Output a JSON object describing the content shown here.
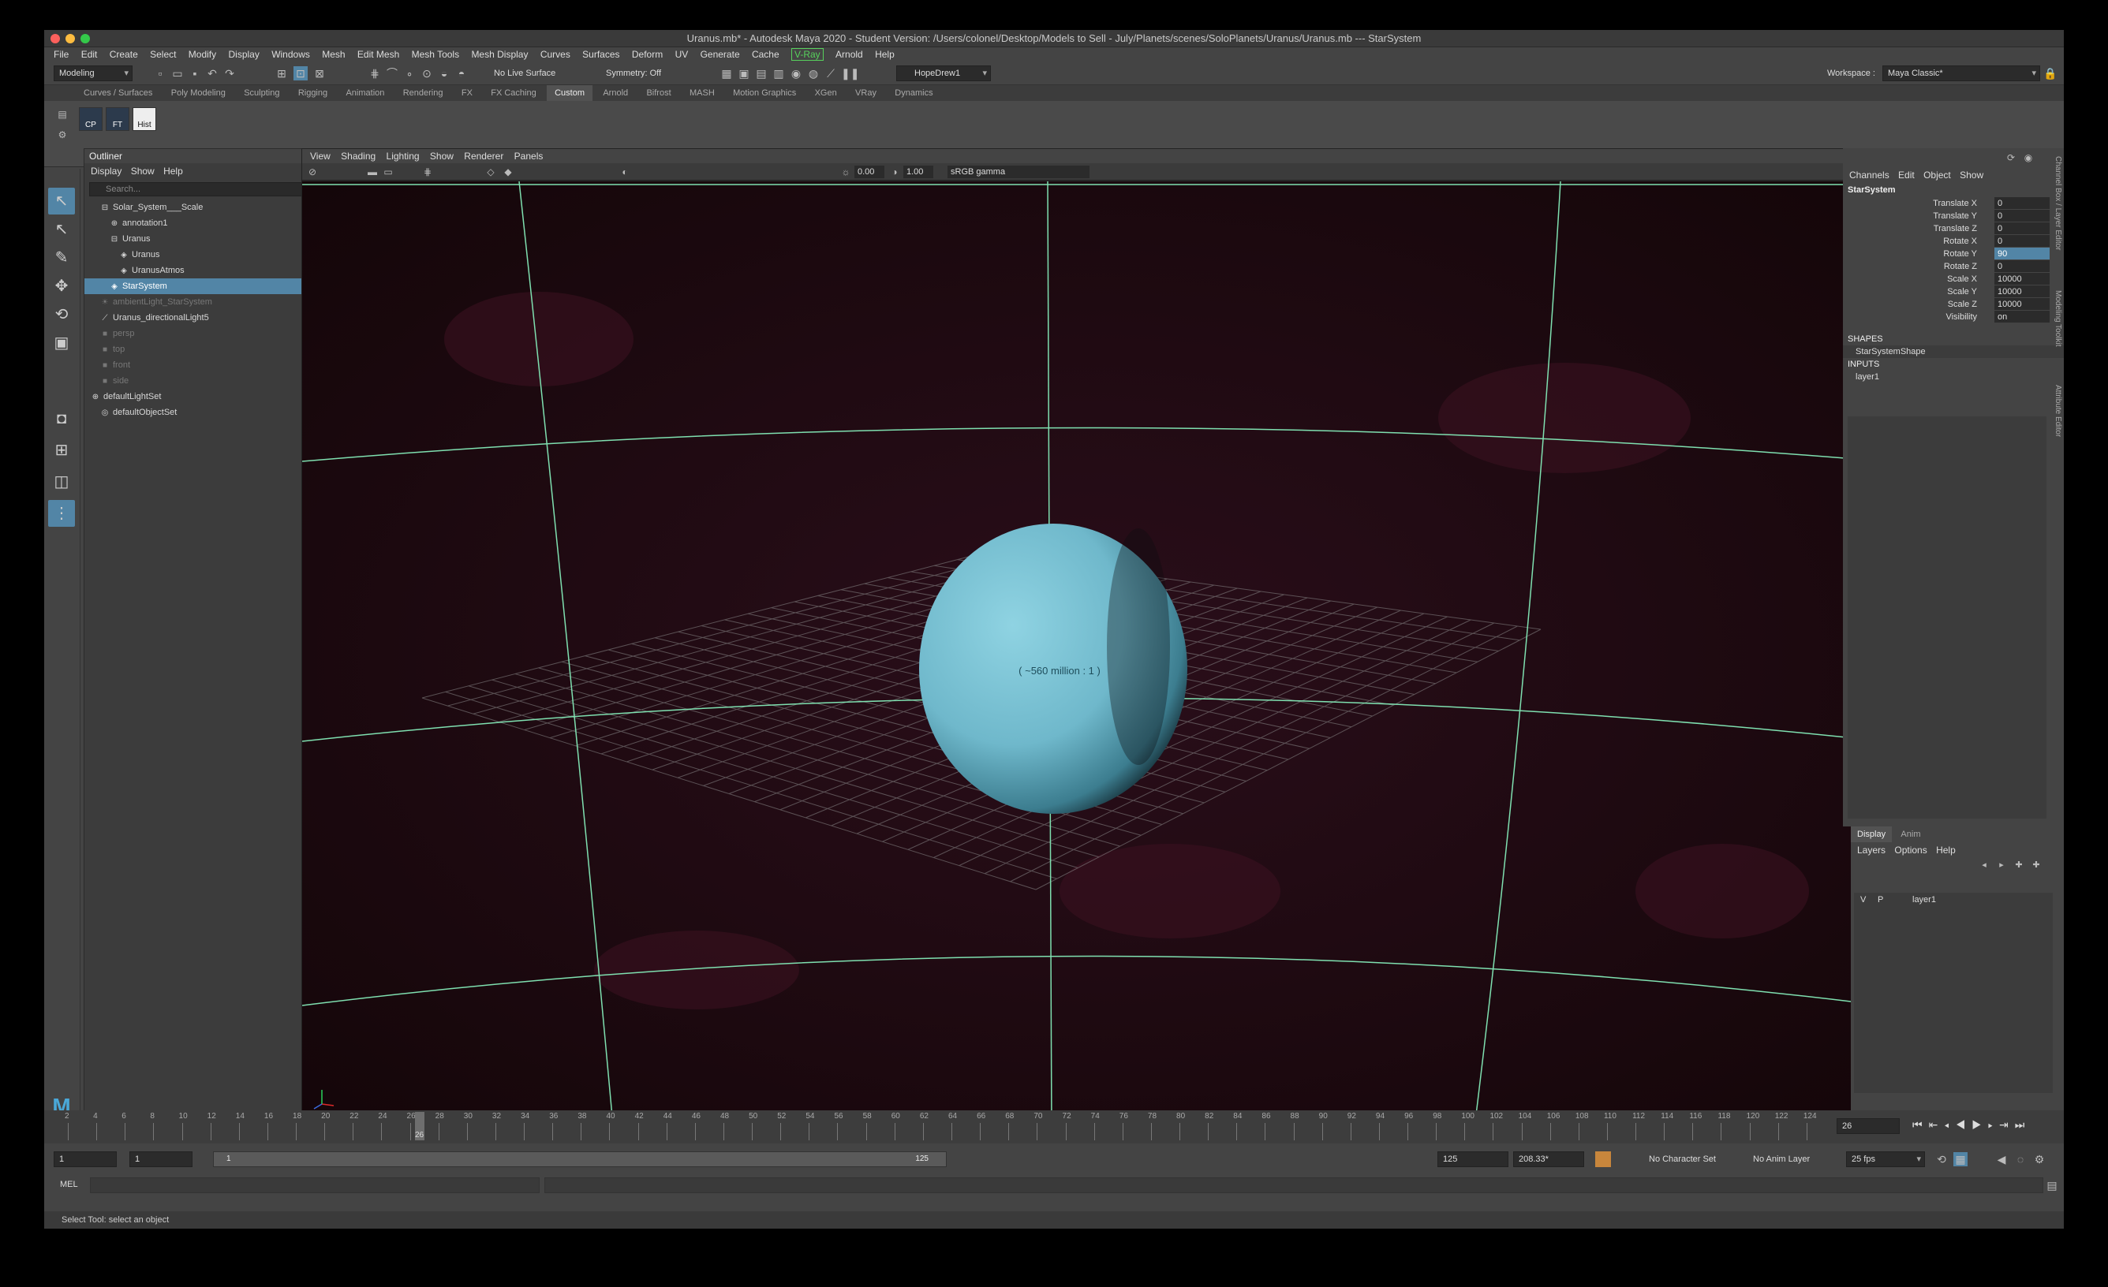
{
  "window": {
    "title": "Uranus.mb* - Autodesk Maya 2020 - Student Version: /Users/colonel/Desktop/Models to Sell - July/Planets/scenes/SoloPlanets/Uranus/Uranus.mb  ---  StarSystem"
  },
  "menubar": [
    "File",
    "Edit",
    "Create",
    "Select",
    "Modify",
    "Display",
    "Windows",
    "Mesh",
    "Edit Mesh",
    "Mesh Tools",
    "Mesh Display",
    "Curves",
    "Surfaces",
    "Deform",
    "UV",
    "Generate",
    "Cache",
    "V-Ray",
    "Arnold",
    "Help"
  ],
  "statusline": {
    "mode": "Modeling",
    "live_surface": "No Live Surface",
    "symmetry": "Symmetry: Off",
    "renderer_cam": "HopeDrew1",
    "workspace_label": "Workspace :",
    "workspace": "Maya Classic*"
  },
  "shelf_tabs": [
    "Curves / Surfaces",
    "Poly Modeling",
    "Sculpting",
    "Rigging",
    "Animation",
    "Rendering",
    "FX",
    "FX Caching",
    "Custom",
    "Arnold",
    "Bifrost",
    "MASH",
    "Motion Graphics",
    "XGen",
    "VRay",
    "Dynamics"
  ],
  "shelf_active": "Custom",
  "shelf_buttons": [
    "CP",
    "FT",
    "Hist"
  ],
  "outliner": {
    "title": "Outliner",
    "menu": [
      "Display",
      "Show",
      "Help"
    ],
    "search_placeholder": "Search...",
    "items": [
      {
        "label": "Solar_System___Scale",
        "indent": 1,
        "icon": "⊟",
        "state": "normal"
      },
      {
        "label": "annotation1",
        "indent": 2,
        "icon": "⊕",
        "state": "normal"
      },
      {
        "label": "Uranus",
        "indent": 2,
        "icon": "⊟",
        "state": "normal"
      },
      {
        "label": "Uranus",
        "indent": 3,
        "icon": "◈",
        "state": "normal"
      },
      {
        "label": "UranusAtmos",
        "indent": 3,
        "icon": "◈",
        "state": "normal"
      },
      {
        "label": "StarSystem",
        "indent": 2,
        "icon": "◈",
        "state": "selected"
      },
      {
        "label": "ambientLight_StarSystem",
        "indent": 1,
        "icon": "☀",
        "state": "dim"
      },
      {
        "label": "Uranus_directionalLight5",
        "indent": 1,
        "icon": "⟋",
        "state": "normal"
      },
      {
        "label": "persp",
        "indent": 1,
        "icon": "■",
        "state": "dim"
      },
      {
        "label": "top",
        "indent": 1,
        "icon": "■",
        "state": "dim"
      },
      {
        "label": "front",
        "indent": 1,
        "icon": "■",
        "state": "dim"
      },
      {
        "label": "side",
        "indent": 1,
        "icon": "■",
        "state": "dim"
      },
      {
        "label": "defaultLightSet",
        "indent": 0,
        "icon": "⊕",
        "state": "normal"
      },
      {
        "label": "defaultObjectSet",
        "indent": 1,
        "icon": "◎",
        "state": "normal"
      }
    ]
  },
  "viewport": {
    "menu": [
      "View",
      "Shading",
      "Lighting",
      "Show",
      "Renderer",
      "Panels"
    ],
    "exposure": "0.00",
    "gamma": "1.00",
    "color_space": "sRGB gamma",
    "annotation": "( ~560 million : 1 )",
    "camera": "persp"
  },
  "channel_box": {
    "menu": [
      "Channels",
      "Edit",
      "Object",
      "Show"
    ],
    "object": "StarSystem",
    "attributes": [
      {
        "name": "Translate X",
        "value": "0"
      },
      {
        "name": "Translate Y",
        "value": "0"
      },
      {
        "name": "Translate Z",
        "value": "0"
      },
      {
        "name": "Rotate X",
        "value": "0"
      },
      {
        "name": "Rotate Y",
        "value": "90",
        "highlight": true
      },
      {
        "name": "Rotate Z",
        "value": "0"
      },
      {
        "name": "Scale X",
        "value": "10000"
      },
      {
        "name": "Scale Y",
        "value": "10000"
      },
      {
        "name": "Scale Z",
        "value": "10000"
      },
      {
        "name": "Visibility",
        "value": "on"
      }
    ],
    "shapes_header": "SHAPES",
    "shape": "StarSystemShape",
    "inputs_header": "INPUTS",
    "input": "layer1"
  },
  "side_tabs": [
    "Channel Box / Layer Editor",
    "Modeling Toolkit",
    "Attribute Editor"
  ],
  "layer_editor": {
    "tabs": [
      "Display",
      "Anim"
    ],
    "menu": [
      "Layers",
      "Options",
      "Help"
    ],
    "layer": {
      "v": "V",
      "p": "P",
      "name": "layer1"
    }
  },
  "timeline": {
    "ticks": [
      "2",
      "4",
      "6",
      "8",
      "10",
      "12",
      "14",
      "16",
      "18",
      "20",
      "22",
      "24",
      "26",
      "28",
      "30",
      "32",
      "34",
      "36",
      "38",
      "40",
      "42",
      "44",
      "46",
      "48",
      "50",
      "52",
      "54",
      "56",
      "58",
      "60",
      "62",
      "64",
      "66",
      "68",
      "70",
      "72",
      "74",
      "76",
      "78",
      "80",
      "82",
      "84",
      "86",
      "88",
      "90",
      "92",
      "94",
      "96",
      "98",
      "100",
      "102",
      "104",
      "106",
      "108",
      "110",
      "112",
      "114",
      "116",
      "118",
      "120",
      "122",
      "124"
    ],
    "current_frame": "26",
    "current_frame_field": "26"
  },
  "range": {
    "start": "1",
    "start2": "1",
    "slider_start": "1",
    "slider_end": "125",
    "end": "125",
    "end2": "208.33*",
    "character_set": "No Character Set",
    "anim_layer": "No Anim Layer",
    "fps": "25 fps"
  },
  "command": {
    "label": "MEL"
  },
  "helpline": "Select Tool: select an object",
  "colors": {
    "accent": "#5285a6",
    "vray": "#57d15c",
    "grid_lines": "#7fe0b0",
    "planet": "#7ec7d8"
  }
}
